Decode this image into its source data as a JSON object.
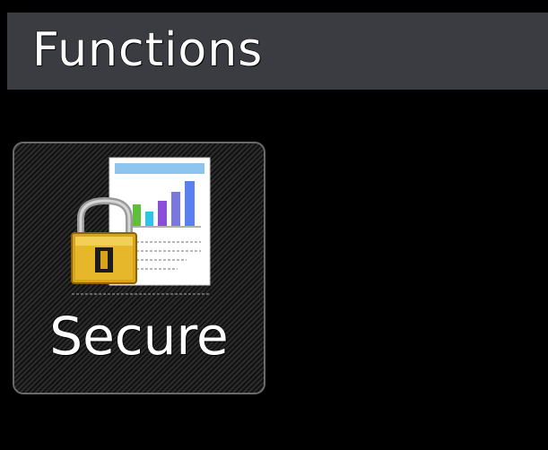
{
  "header": {
    "title": "Functions"
  },
  "functions": [
    {
      "label": "Secure",
      "icon": "secure-print-lock-icon"
    }
  ],
  "colors": {
    "background": "#000000",
    "header_bar": "#3a3c41",
    "tile_border": "#6a6a6a",
    "lock_gold": "#d9a419",
    "chart_bar_green": "#5fbf3a",
    "chart_bar_cyan": "#2ec4e6",
    "chart_bar_purple": "#8a4fd6",
    "chart_bar_blue": "#5a7ff0"
  }
}
